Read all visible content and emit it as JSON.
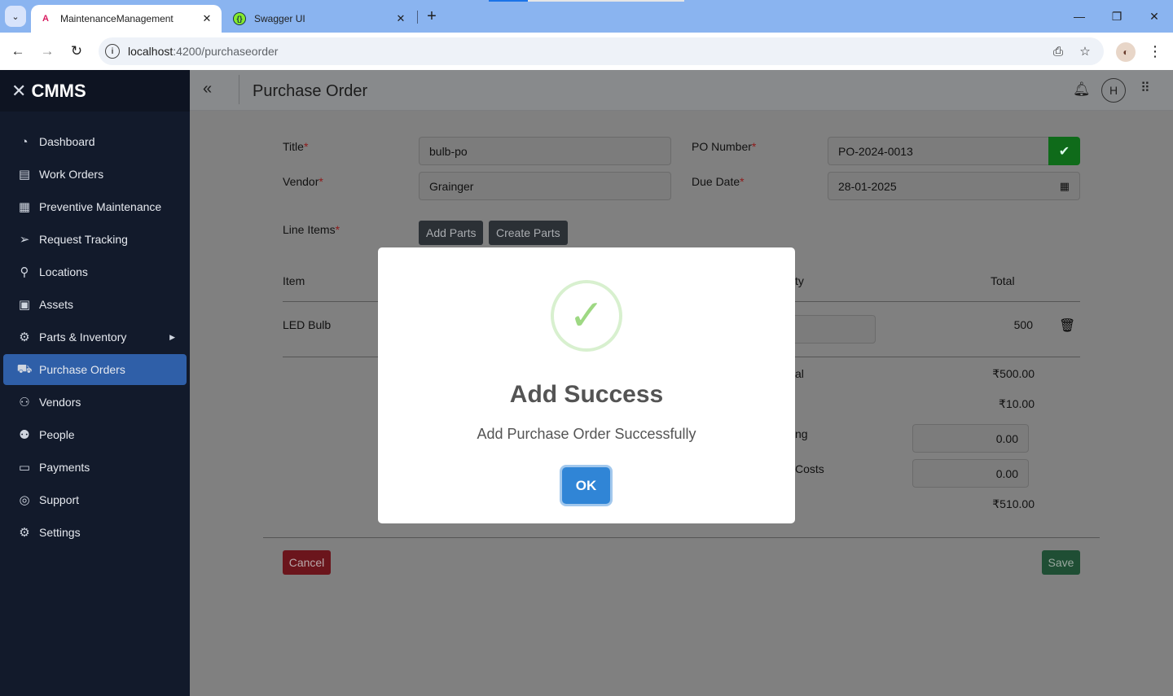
{
  "browser": {
    "tabs": [
      {
        "title": "MaintenanceManagement",
        "favicon": "angular-icon"
      },
      {
        "title": "Swagger UI",
        "favicon": "swagger-icon"
      }
    ],
    "url_host": "localhost",
    "url_path": ":4200/purchaseorder"
  },
  "app": {
    "brand": "CMMS",
    "page_title": "Purchase Order",
    "user_initial": "H"
  },
  "sidebar": {
    "items": [
      {
        "label": "Dashboard",
        "icon": "dashboard-icon"
      },
      {
        "label": "Work Orders",
        "icon": "clipboard-icon"
      },
      {
        "label": "Preventive Maintenance",
        "icon": "calendar-icon"
      },
      {
        "label": "Request Tracking",
        "icon": "send-icon"
      },
      {
        "label": "Locations",
        "icon": "map-pin-icon"
      },
      {
        "label": "Assets",
        "icon": "boxes-icon"
      },
      {
        "label": "Parts & Inventory",
        "icon": "parts-icon"
      },
      {
        "label": "Purchase Orders",
        "icon": "cart-icon"
      },
      {
        "label": "Vendors",
        "icon": "vendors-icon"
      },
      {
        "label": "People",
        "icon": "people-icon"
      },
      {
        "label": "Payments",
        "icon": "card-icon"
      },
      {
        "label": "Support",
        "icon": "lifebuoy-icon"
      },
      {
        "label": "Settings",
        "icon": "gear-icon"
      }
    ],
    "active_item": "Purchase Orders"
  },
  "form": {
    "title_label": "Title",
    "title_value": "bulb-po",
    "po_number_label": "PO Number",
    "po_number_value": "PO-2024-0013",
    "vendor_label": "Vendor",
    "vendor_value": "Grainger",
    "due_date_label": "Due Date",
    "due_date_value": "28-01-2025",
    "line_items_label": "Line Items",
    "add_parts_label": "Add Parts",
    "create_parts_label": "Create Parts",
    "required_mark": "*"
  },
  "table": {
    "headers": {
      "item": "Item",
      "qty_partial": "ty",
      "total": "Total"
    },
    "rows": [
      {
        "item": "LED Bulb",
        "total": "500"
      }
    ]
  },
  "summary": {
    "subtotal_label_partial": "al",
    "subtotal_value": "₹500.00",
    "tax_value": "₹10.00",
    "shipping_label_partial": "ng",
    "shipping_value": "0.00",
    "other_label_partial": "Costs",
    "other_value": "0.00",
    "grand_total_value": "₹510.00"
  },
  "actions": {
    "cancel_label": "Cancel",
    "save_label": "Save"
  },
  "modal": {
    "title": "Add Success",
    "message": "Add Purchase Order Successfully",
    "ok_label": "OK"
  },
  "colors": {
    "sidebar_bg": "#121a2b",
    "active_nav": "#2f5fa8",
    "ok_button": "#3085d6",
    "success_green": "#9ed883"
  }
}
